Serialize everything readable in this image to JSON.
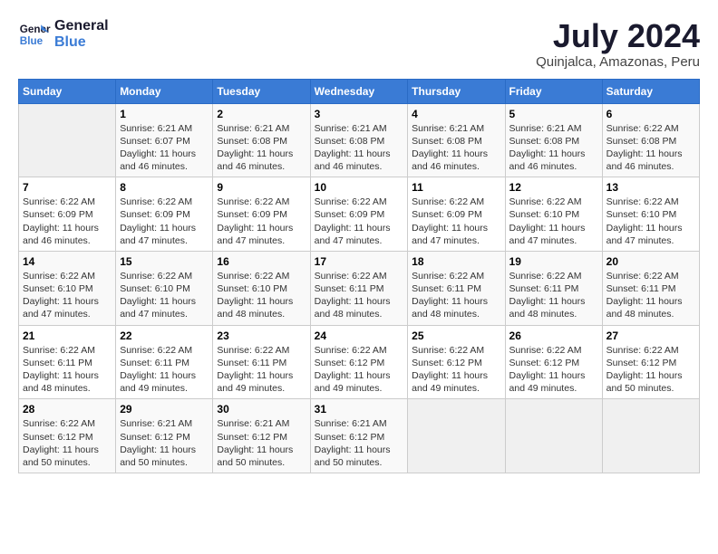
{
  "header": {
    "logo_line1": "General",
    "logo_line2": "Blue",
    "month": "July 2024",
    "location": "Quinjalca, Amazonas, Peru"
  },
  "days_of_week": [
    "Sunday",
    "Monday",
    "Tuesday",
    "Wednesday",
    "Thursday",
    "Friday",
    "Saturday"
  ],
  "weeks": [
    [
      {
        "day": "",
        "empty": true
      },
      {
        "day": "1",
        "sunrise": "6:21 AM",
        "sunset": "6:07 PM",
        "daylight": "11 hours and 46 minutes."
      },
      {
        "day": "2",
        "sunrise": "6:21 AM",
        "sunset": "6:08 PM",
        "daylight": "11 hours and 46 minutes."
      },
      {
        "day": "3",
        "sunrise": "6:21 AM",
        "sunset": "6:08 PM",
        "daylight": "11 hours and 46 minutes."
      },
      {
        "day": "4",
        "sunrise": "6:21 AM",
        "sunset": "6:08 PM",
        "daylight": "11 hours and 46 minutes."
      },
      {
        "day": "5",
        "sunrise": "6:21 AM",
        "sunset": "6:08 PM",
        "daylight": "11 hours and 46 minutes."
      },
      {
        "day": "6",
        "sunrise": "6:22 AM",
        "sunset": "6:08 PM",
        "daylight": "11 hours and 46 minutes."
      }
    ],
    [
      {
        "day": "7",
        "sunrise": "6:22 AM",
        "sunset": "6:09 PM",
        "daylight": "11 hours and 46 minutes."
      },
      {
        "day": "8",
        "sunrise": "6:22 AM",
        "sunset": "6:09 PM",
        "daylight": "11 hours and 47 minutes."
      },
      {
        "day": "9",
        "sunrise": "6:22 AM",
        "sunset": "6:09 PM",
        "daylight": "11 hours and 47 minutes."
      },
      {
        "day": "10",
        "sunrise": "6:22 AM",
        "sunset": "6:09 PM",
        "daylight": "11 hours and 47 minutes."
      },
      {
        "day": "11",
        "sunrise": "6:22 AM",
        "sunset": "6:09 PM",
        "daylight": "11 hours and 47 minutes."
      },
      {
        "day": "12",
        "sunrise": "6:22 AM",
        "sunset": "6:10 PM",
        "daylight": "11 hours and 47 minutes."
      },
      {
        "day": "13",
        "sunrise": "6:22 AM",
        "sunset": "6:10 PM",
        "daylight": "11 hours and 47 minutes."
      }
    ],
    [
      {
        "day": "14",
        "sunrise": "6:22 AM",
        "sunset": "6:10 PM",
        "daylight": "11 hours and 47 minutes."
      },
      {
        "day": "15",
        "sunrise": "6:22 AM",
        "sunset": "6:10 PM",
        "daylight": "11 hours and 47 minutes."
      },
      {
        "day": "16",
        "sunrise": "6:22 AM",
        "sunset": "6:10 PM",
        "daylight": "11 hours and 48 minutes."
      },
      {
        "day": "17",
        "sunrise": "6:22 AM",
        "sunset": "6:11 PM",
        "daylight": "11 hours and 48 minutes."
      },
      {
        "day": "18",
        "sunrise": "6:22 AM",
        "sunset": "6:11 PM",
        "daylight": "11 hours and 48 minutes."
      },
      {
        "day": "19",
        "sunrise": "6:22 AM",
        "sunset": "6:11 PM",
        "daylight": "11 hours and 48 minutes."
      },
      {
        "day": "20",
        "sunrise": "6:22 AM",
        "sunset": "6:11 PM",
        "daylight": "11 hours and 48 minutes."
      }
    ],
    [
      {
        "day": "21",
        "sunrise": "6:22 AM",
        "sunset": "6:11 PM",
        "daylight": "11 hours and 48 minutes."
      },
      {
        "day": "22",
        "sunrise": "6:22 AM",
        "sunset": "6:11 PM",
        "daylight": "11 hours and 49 minutes."
      },
      {
        "day": "23",
        "sunrise": "6:22 AM",
        "sunset": "6:11 PM",
        "daylight": "11 hours and 49 minutes."
      },
      {
        "day": "24",
        "sunrise": "6:22 AM",
        "sunset": "6:12 PM",
        "daylight": "11 hours and 49 minutes."
      },
      {
        "day": "25",
        "sunrise": "6:22 AM",
        "sunset": "6:12 PM",
        "daylight": "11 hours and 49 minutes."
      },
      {
        "day": "26",
        "sunrise": "6:22 AM",
        "sunset": "6:12 PM",
        "daylight": "11 hours and 49 minutes."
      },
      {
        "day": "27",
        "sunrise": "6:22 AM",
        "sunset": "6:12 PM",
        "daylight": "11 hours and 50 minutes."
      }
    ],
    [
      {
        "day": "28",
        "sunrise": "6:22 AM",
        "sunset": "6:12 PM",
        "daylight": "11 hours and 50 minutes."
      },
      {
        "day": "29",
        "sunrise": "6:21 AM",
        "sunset": "6:12 PM",
        "daylight": "11 hours and 50 minutes."
      },
      {
        "day": "30",
        "sunrise": "6:21 AM",
        "sunset": "6:12 PM",
        "daylight": "11 hours and 50 minutes."
      },
      {
        "day": "31",
        "sunrise": "6:21 AM",
        "sunset": "6:12 PM",
        "daylight": "11 hours and 50 minutes."
      },
      {
        "day": "",
        "empty": true
      },
      {
        "day": "",
        "empty": true
      },
      {
        "day": "",
        "empty": true
      }
    ]
  ],
  "labels": {
    "sunrise": "Sunrise:",
    "sunset": "Sunset:",
    "daylight": "Daylight:"
  }
}
